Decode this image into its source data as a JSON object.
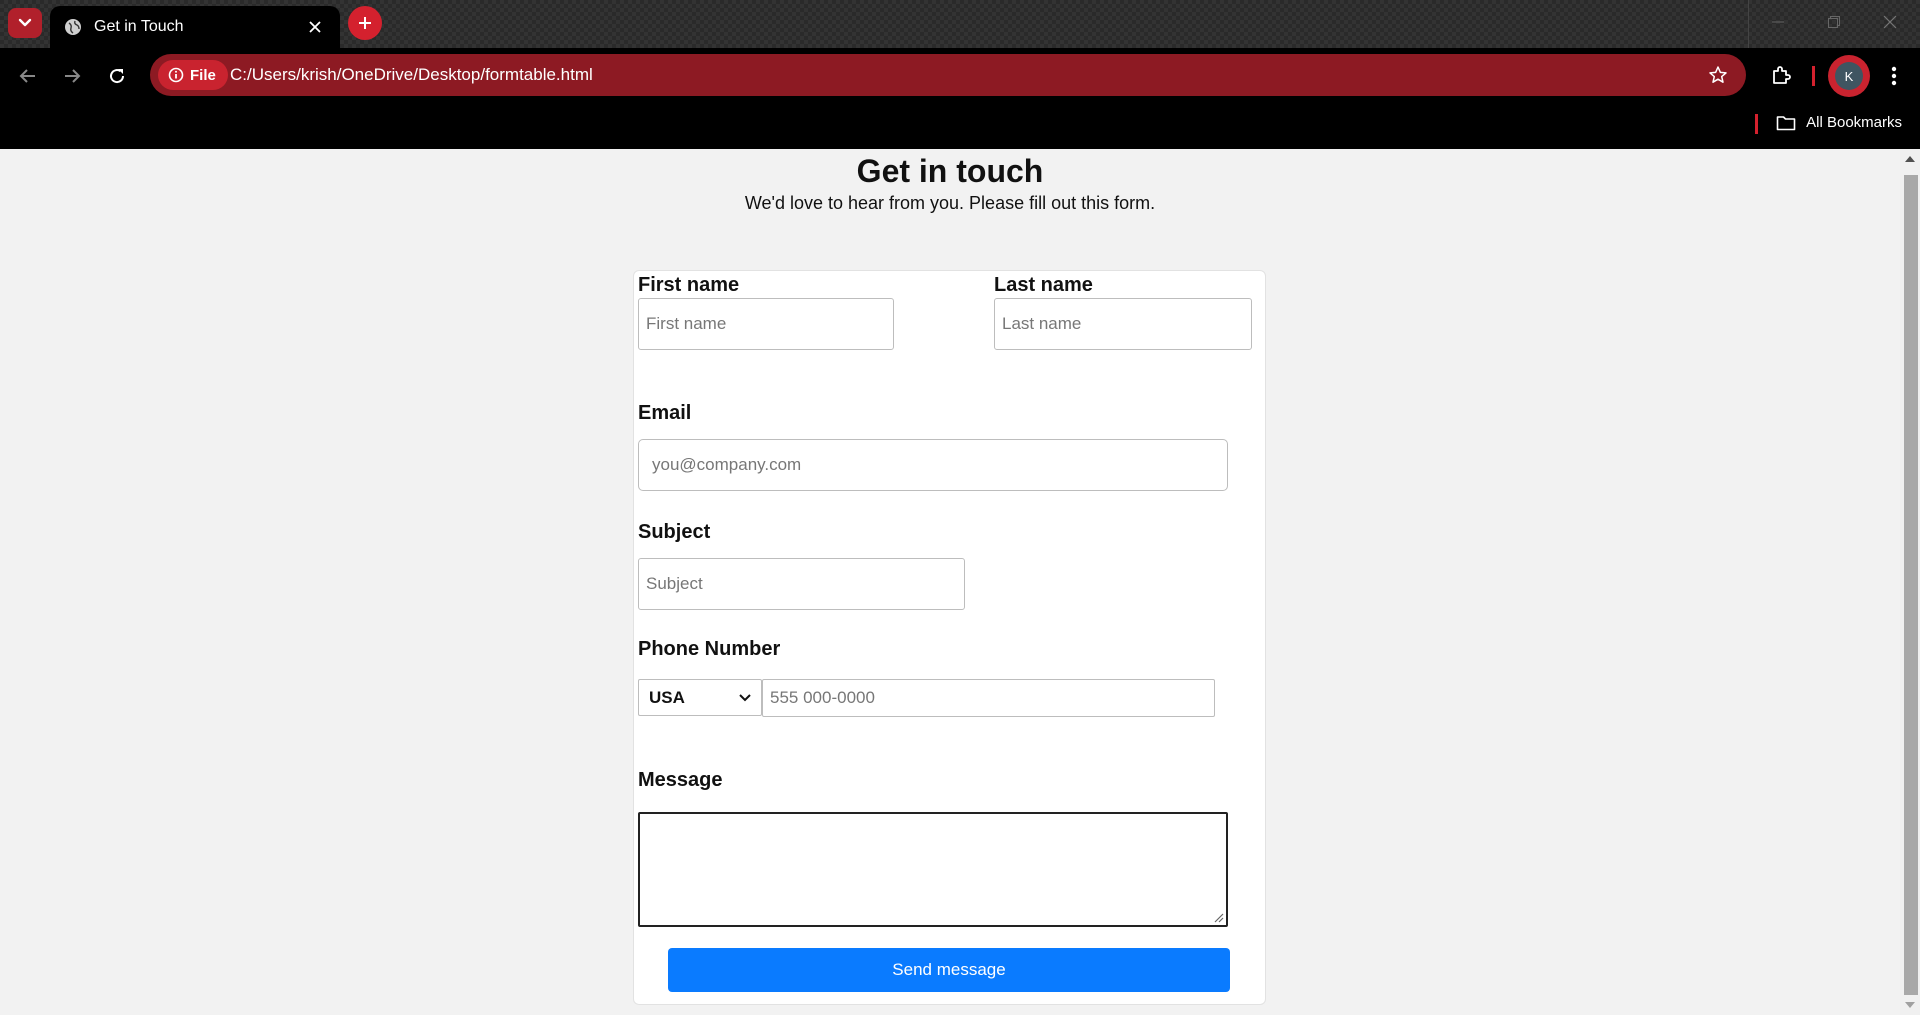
{
  "browser": {
    "tab_title": "Get in Touch",
    "site_chip_label": "File",
    "url": "C:/Users/krish/OneDrive/Desktop/formtable.html",
    "profile_initial": "K",
    "bookmarks_label": "All Bookmarks",
    "accent_color": "#d4212e",
    "icons": [
      "tab-search-icon",
      "globe-icon",
      "close-icon",
      "plus-icon",
      "minimize-icon",
      "restore-icon",
      "back-icon",
      "forward-icon",
      "reload-icon",
      "info-icon",
      "star-icon",
      "extensions-icon",
      "kebab-menu-icon",
      "folder-icon"
    ]
  },
  "page": {
    "title": "Get in touch",
    "subtitle": "We'd love to hear from you. Please fill out this form."
  },
  "form": {
    "first_name": {
      "label": "First name",
      "placeholder": "First name",
      "value": ""
    },
    "last_name": {
      "label": "Last name",
      "placeholder": "Last name",
      "value": ""
    },
    "email": {
      "label": "Email",
      "placeholder": "you@company.com",
      "value": ""
    },
    "subject": {
      "label": "Subject",
      "placeholder": "Subject",
      "value": ""
    },
    "phone": {
      "label": "Phone Number",
      "country": "USA",
      "placeholder": "555 000-0000",
      "value": ""
    },
    "message": {
      "label": "Message",
      "value": ""
    },
    "submit_label": "Send message",
    "submit_color": "#0a7bff"
  }
}
